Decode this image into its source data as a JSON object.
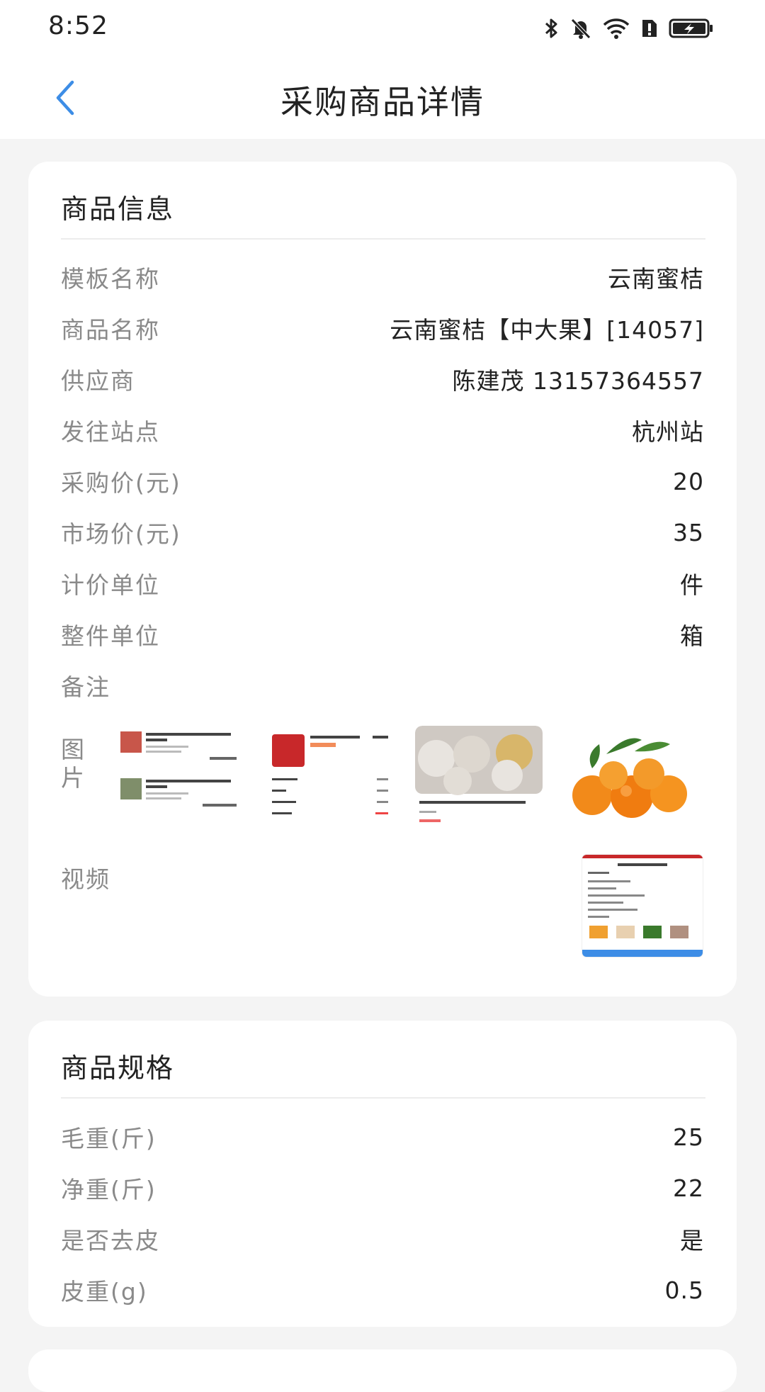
{
  "status_bar": {
    "time": "8:52"
  },
  "header": {
    "title": "采购商品详情",
    "back_icon": "chevron-left-icon"
  },
  "product_info": {
    "section_title": "商品信息",
    "rows": [
      {
        "label": "模板名称",
        "value": "云南蜜桔"
      },
      {
        "label": "商品名称",
        "value": "云南蜜桔【中大果】[14057]"
      },
      {
        "label": "供应商",
        "value": "陈建茂 13157364557"
      },
      {
        "label": "发往站点",
        "value": "杭州站"
      },
      {
        "label": "采购价(元)",
        "value": "20"
      },
      {
        "label": "市场价(元)",
        "value": "35"
      },
      {
        "label": "计价单位",
        "value": "件"
      },
      {
        "label": "整件单位",
        "value": "箱"
      },
      {
        "label": "备注",
        "value": ""
      }
    ],
    "images_label": "图片",
    "video_label": "视频"
  },
  "product_spec": {
    "section_title": "商品规格",
    "rows": [
      {
        "label": "毛重(斤)",
        "value": "25"
      },
      {
        "label": "净重(斤)",
        "value": "22"
      },
      {
        "label": "是否去皮",
        "value": "是"
      },
      {
        "label": "皮重(g)",
        "value": "0.5"
      }
    ]
  },
  "colors": {
    "accent": "#3d8de6",
    "label": "#8a8a8a",
    "value": "#222222",
    "background": "#f4f4f4"
  }
}
